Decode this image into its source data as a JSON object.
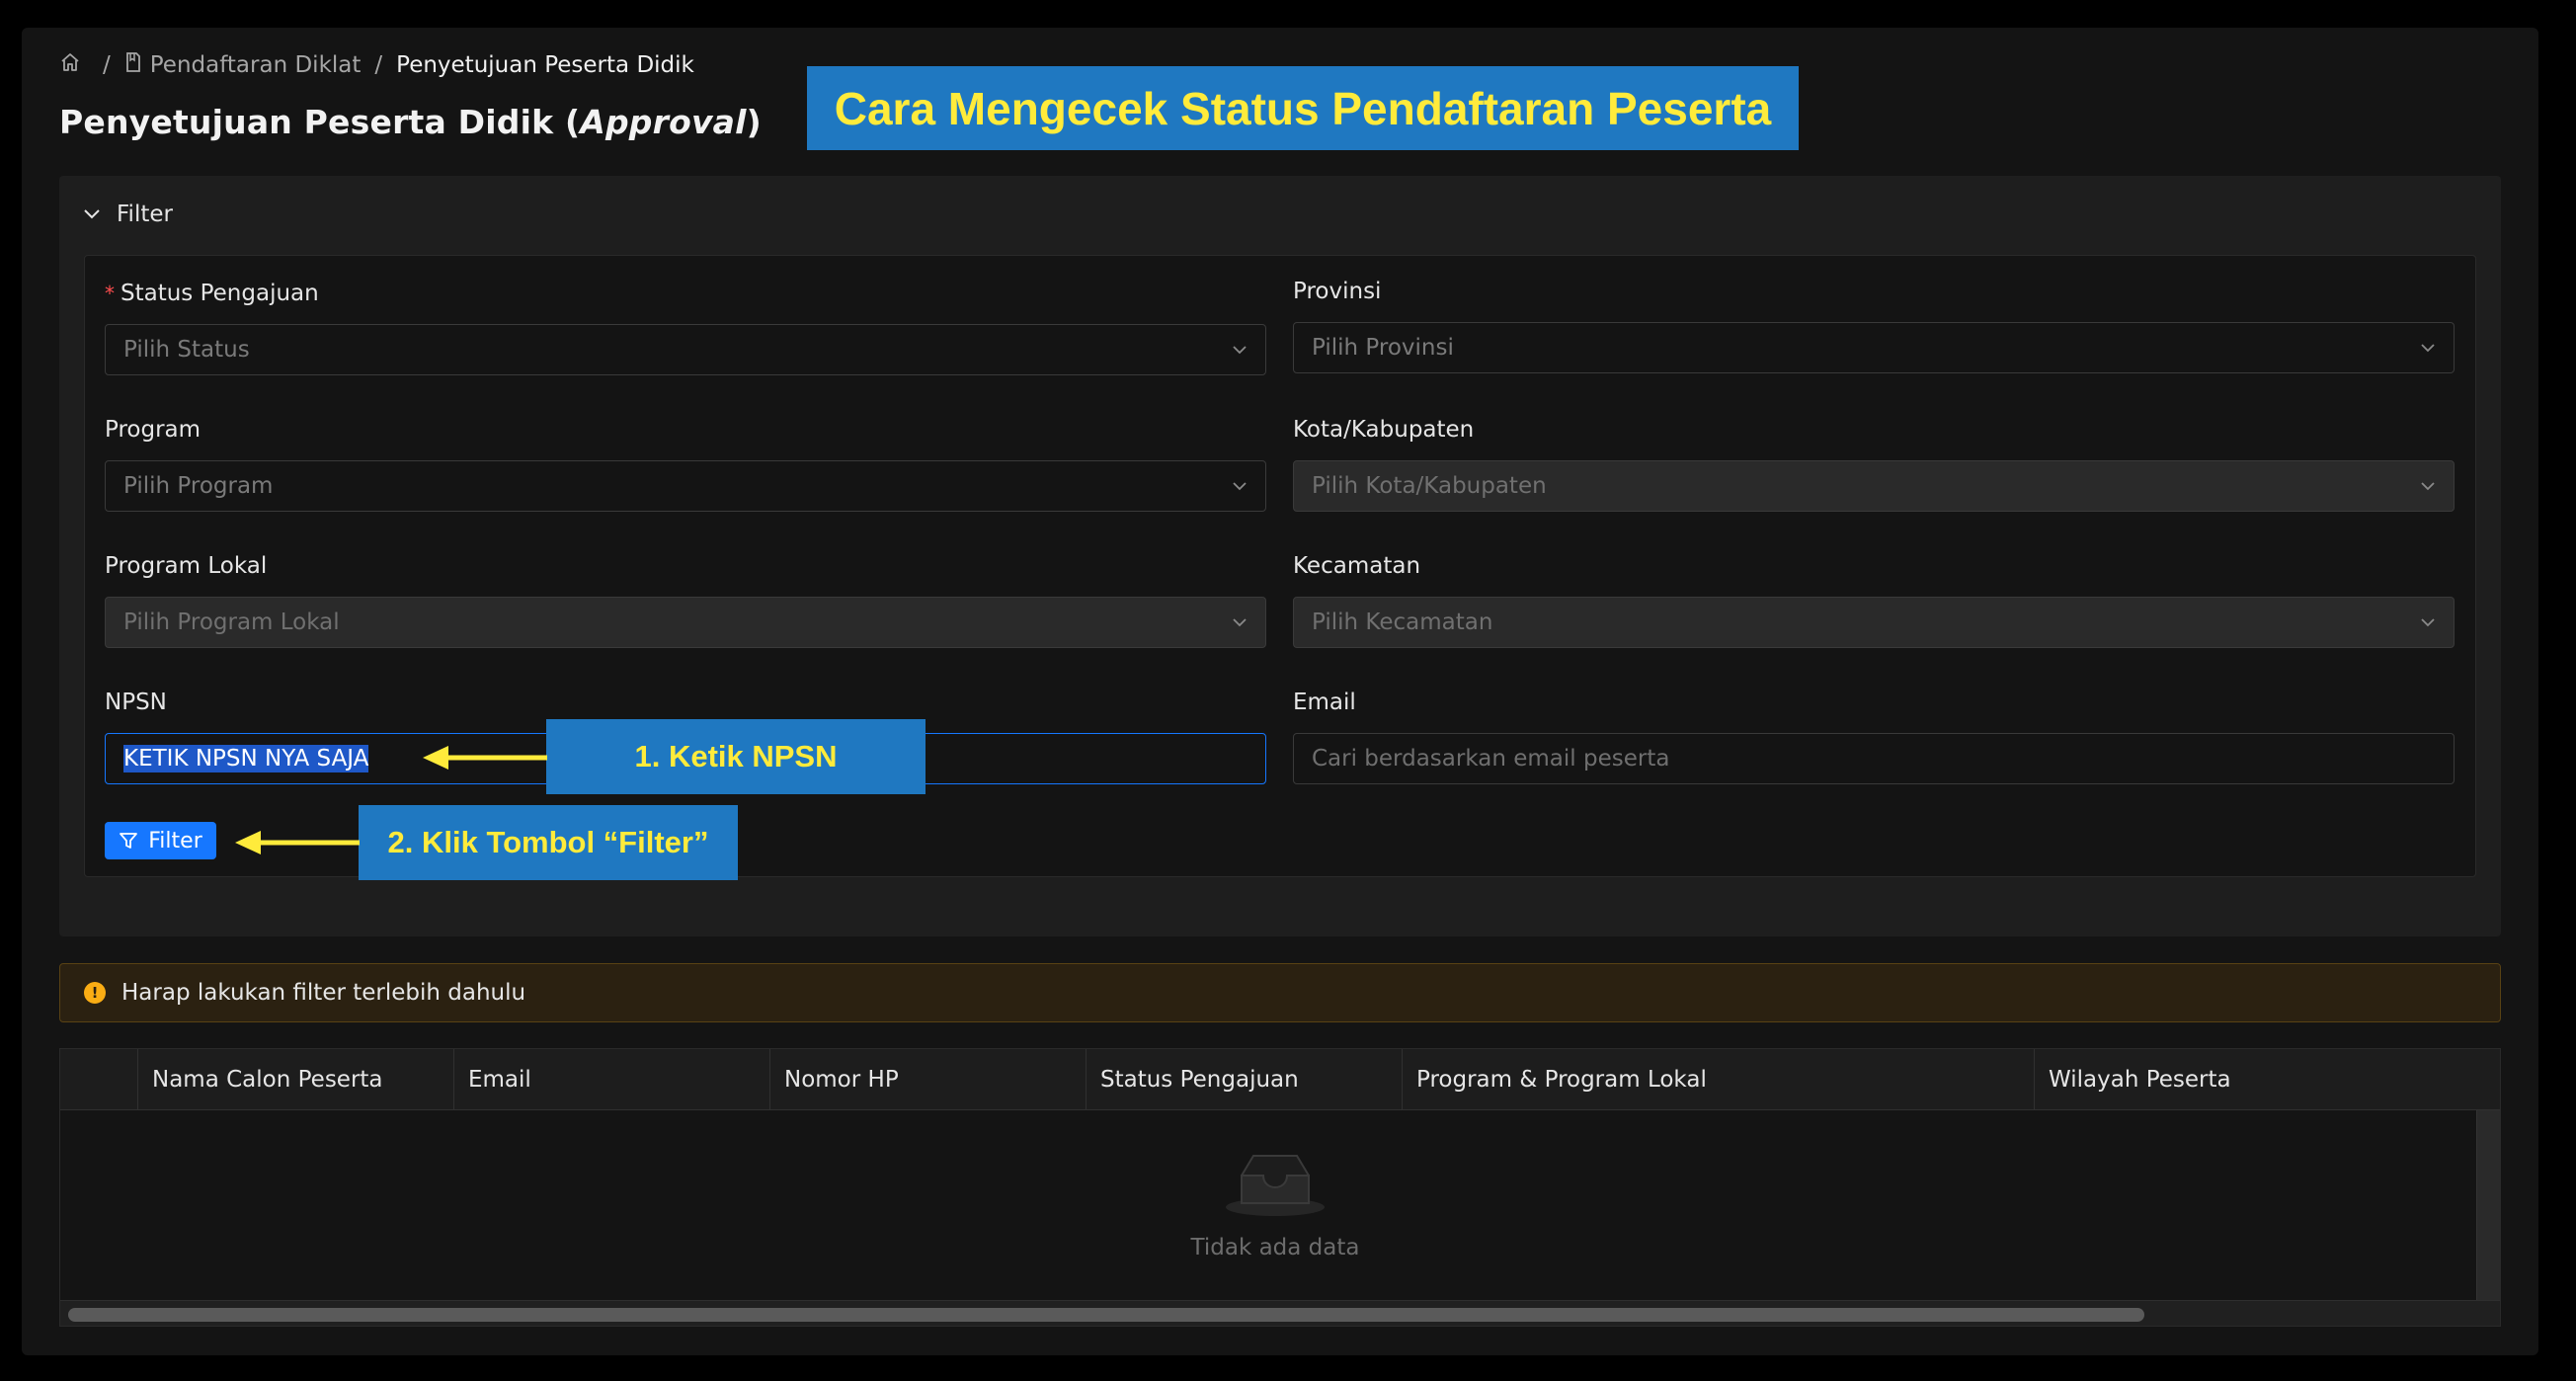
{
  "breadcrumb": {
    "home_icon": "home-icon",
    "page_icon": "document-icon",
    "item1": "Pendaftaran Diklat",
    "item2": "Penyetujuan Peserta Didik",
    "separator": "/"
  },
  "page_title": {
    "main": "Penyetujuan Peserta Didik (",
    "italic": "Approval",
    "end": ")"
  },
  "banner": {
    "text": "Cara Mengecek Status Pendaftaran Peserta"
  },
  "filter": {
    "header_label": "Filter",
    "status": {
      "label": "Status Pengajuan",
      "placeholder": "Pilih Status",
      "required_mark": "*"
    },
    "provinsi": {
      "label": "Provinsi",
      "placeholder": "Pilih Provinsi"
    },
    "program": {
      "label": "Program",
      "placeholder": "Pilih Program"
    },
    "kota": {
      "label": "Kota/Kabupaten",
      "placeholder": "Pilih Kota/Kabupaten"
    },
    "program_lokal": {
      "label": "Program Lokal",
      "placeholder": "Pilih Program Lokal"
    },
    "kecamatan": {
      "label": "Kecamatan",
      "placeholder": "Pilih Kecamatan"
    },
    "npsn": {
      "label": "NPSN",
      "value": "KETIK NPSN NYA SAJA"
    },
    "email": {
      "label": "Email",
      "placeholder": "Cari berdasarkan email peserta"
    },
    "button_label": "Filter"
  },
  "callouts": {
    "step1": "1. Ketik NPSN",
    "step2": "2. Klik Tombol “Filter”"
  },
  "alert": {
    "text": "Harap lakukan filter terlebih dahulu",
    "icon": "warning-icon"
  },
  "table": {
    "columns": [
      "Nama Calon Peserta",
      "Email",
      "Nomor HP",
      "Status Pengajuan",
      "Program & Program Lokal",
      "Wilayah Peserta"
    ],
    "empty_text": "Tidak ada data"
  },
  "colors": {
    "accent": "#1677ff",
    "callout_bg": "#1f78c1",
    "callout_text": "#ffeb3b",
    "arrow": "#ffeb3b",
    "warning": "#faad14"
  }
}
